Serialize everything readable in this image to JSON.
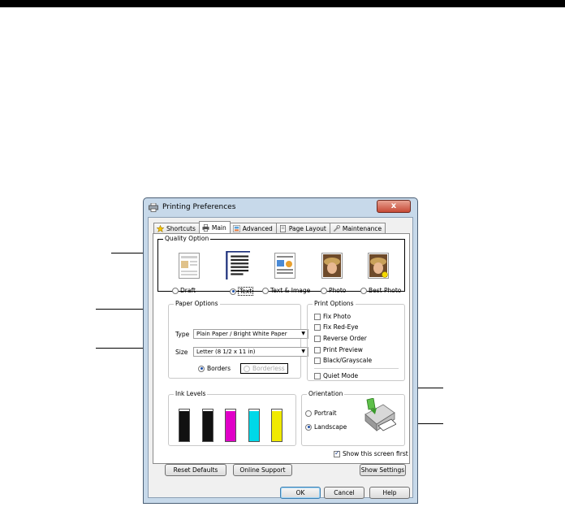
{
  "window": {
    "title": "Printing Preferences",
    "close_glyph": "x"
  },
  "tabs": [
    {
      "label": "Shortcuts",
      "icon": "star-icon",
      "active": false
    },
    {
      "label": "Main",
      "icon": "printer-icon",
      "active": true
    },
    {
      "label": "Advanced",
      "icon": "advanced-icon",
      "active": false
    },
    {
      "label": "Page Layout",
      "icon": "page-icon",
      "active": false
    },
    {
      "label": "Maintenance",
      "icon": "wrench-icon",
      "active": false
    }
  ],
  "quality": {
    "title": "Quality Option",
    "options": [
      {
        "label": "Draft",
        "selected": false
      },
      {
        "label": "Text",
        "selected": true
      },
      {
        "label": "Text & Image",
        "selected": false
      },
      {
        "label": "Photo",
        "selected": false
      },
      {
        "label": "Best Photo",
        "selected": false
      }
    ]
  },
  "paper": {
    "title": "Paper Options",
    "type_label": "Type",
    "type_value": "Plain Paper / Bright White Paper",
    "size_label": "Size",
    "size_value": "Letter (8 1/2 x 11 in)",
    "borders_label": "Borders",
    "borderless_label": "Borderless",
    "borders_selected": true
  },
  "print_options": {
    "title": "Print Options",
    "items": [
      {
        "label": "Fix Photo",
        "checked": false
      },
      {
        "label": "Fix Red-Eye",
        "checked": false
      },
      {
        "label": "Reverse Order",
        "checked": false
      },
      {
        "label": "Print Preview",
        "checked": false
      },
      {
        "label": "Black/Grayscale",
        "checked": false
      }
    ],
    "quiet_mode": {
      "label": "Quiet Mode",
      "checked": false
    }
  },
  "ink": {
    "title": "Ink Levels",
    "cartridges": [
      {
        "color": "#111111",
        "level": 0.95
      },
      {
        "color": "#111111",
        "level": 0.95
      },
      {
        "color": "#e000c8",
        "level": 0.95
      },
      {
        "color": "#00d8e8",
        "level": 0.95
      },
      {
        "color": "#f0ea00",
        "level": 0.95
      }
    ]
  },
  "orientation": {
    "title": "Orientation",
    "portrait_label": "Portrait",
    "landscape_label": "Landscape",
    "landscape_selected": true
  },
  "show_first": {
    "label": "Show this screen first",
    "checked": true
  },
  "buttons": {
    "reset": "Reset Defaults",
    "support": "Online Support",
    "show_settings": "Show Settings",
    "ok": "OK",
    "cancel": "Cancel",
    "help": "Help"
  }
}
